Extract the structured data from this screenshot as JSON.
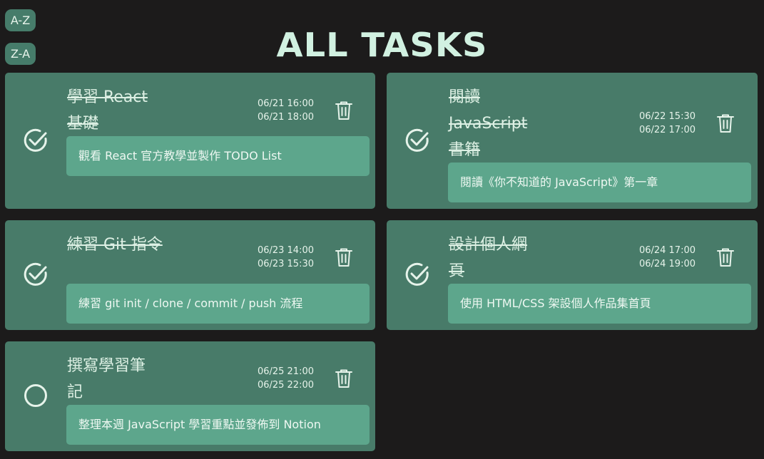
{
  "sort": {
    "az_label": "A-Z",
    "za_label": "Z-A"
  },
  "header": {
    "title": "ALL TASKS"
  },
  "tasks": [
    {
      "title": "學習 React 基礎",
      "start": "06/21 16:00",
      "end": "06/21 18:00",
      "description": "觀看 React 官方教學並製作 TODO List",
      "completed": true
    },
    {
      "title": "閱讀 JavaScript 書籍",
      "start": "06/22 15:30",
      "end": "06/22 17:00",
      "description": "閱讀《你不知道的 JavaScript》第一章",
      "completed": true
    },
    {
      "title": "練習 Git 指令",
      "start": "06/23 14:00",
      "end": "06/23 15:30",
      "description": "練習 git init / clone / commit / push 流程",
      "completed": true
    },
    {
      "title": "設計個人網頁",
      "start": "06/24 17:00",
      "end": "06/24 19:00",
      "description": "使用 HTML/CSS 架設個人作品集首頁",
      "completed": true
    },
    {
      "title": "撰寫學習筆記",
      "start": "06/25 21:00",
      "end": "06/25 22:00",
      "description": "整理本週 JavaScript 學習重點並發佈到 Notion",
      "completed": false
    }
  ],
  "icons": {
    "complete": "check-circle-icon",
    "incomplete": "empty-circle-icon",
    "delete": "trash-icon"
  },
  "colors": {
    "background": "#1c1b1b",
    "card": "#487b69",
    "description": "#5da68c",
    "accent": "#d1f1e1"
  }
}
